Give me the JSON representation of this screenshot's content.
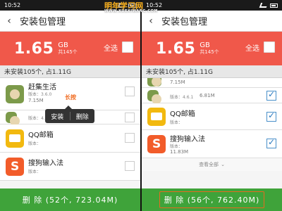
{
  "left": {
    "statusbar": {
      "time": "10:52"
    },
    "titlebar": {
      "title": "安装包管理"
    },
    "summary": {
      "size_value": "1.65",
      "size_unit": "GB",
      "size_count": "共145个",
      "select_all": "全选"
    },
    "section": {
      "label": "未安装105个, 占1.11G"
    },
    "items": [
      {
        "name": "赶集生活",
        "version": "版本：3.6.0",
        "size": "7.15M",
        "icon": "deer-icon",
        "checked": false
      },
      {
        "name": "",
        "version": "版本：4.6.1",
        "size": "",
        "icon": "deer-icon",
        "checked": false
      },
      {
        "name": "QQ邮箱",
        "version": "版本：",
        "size": "",
        "icon": "mail-icon",
        "checked": false
      },
      {
        "name": "搜狗输入法",
        "version": "版本：",
        "size": "",
        "icon": "sogou-icon",
        "checked": false
      }
    ],
    "popup": {
      "longpress_label": "长按",
      "install": "安装",
      "delete": "删除"
    },
    "bottom": {
      "label": "删 除 (52个, 723.04M)"
    }
  },
  "right": {
    "statusbar": {
      "time": "10:52"
    },
    "titlebar": {
      "title": "安装包管理"
    },
    "summary": {
      "size_value": "1.65",
      "size_unit": "GB",
      "size_count": "共145个",
      "select_all": "全选"
    },
    "section": {
      "label": "未安装105个, 占1.11G"
    },
    "items": [
      {
        "name": "",
        "version": "",
        "size": "7.15M",
        "icon": "deer-icon",
        "checked": true
      },
      {
        "name": "",
        "version": "版本：4.6.1",
        "size": "6.81M",
        "icon": "deer-icon",
        "checked": true
      },
      {
        "name": "QQ邮箱",
        "version": "版本：",
        "size": "",
        "icon": "mail-icon",
        "checked": true
      },
      {
        "name": "搜狗输入法",
        "version": "版本：",
        "size": "11.83M",
        "icon": "sogou-icon",
        "checked": true
      }
    ],
    "more": {
      "label": "查看全部"
    },
    "bottom": {
      "label": "删 除 (56个, 762.40M)"
    },
    "watermark": {
      "text": "明年学习网",
      "sub": "WWW.XUEXIWANG.COM"
    }
  },
  "colors": {
    "accent": "#f0584a",
    "action": "#3fa33a",
    "highlight": "#f06a1f",
    "watermark": "#fbb01a"
  }
}
